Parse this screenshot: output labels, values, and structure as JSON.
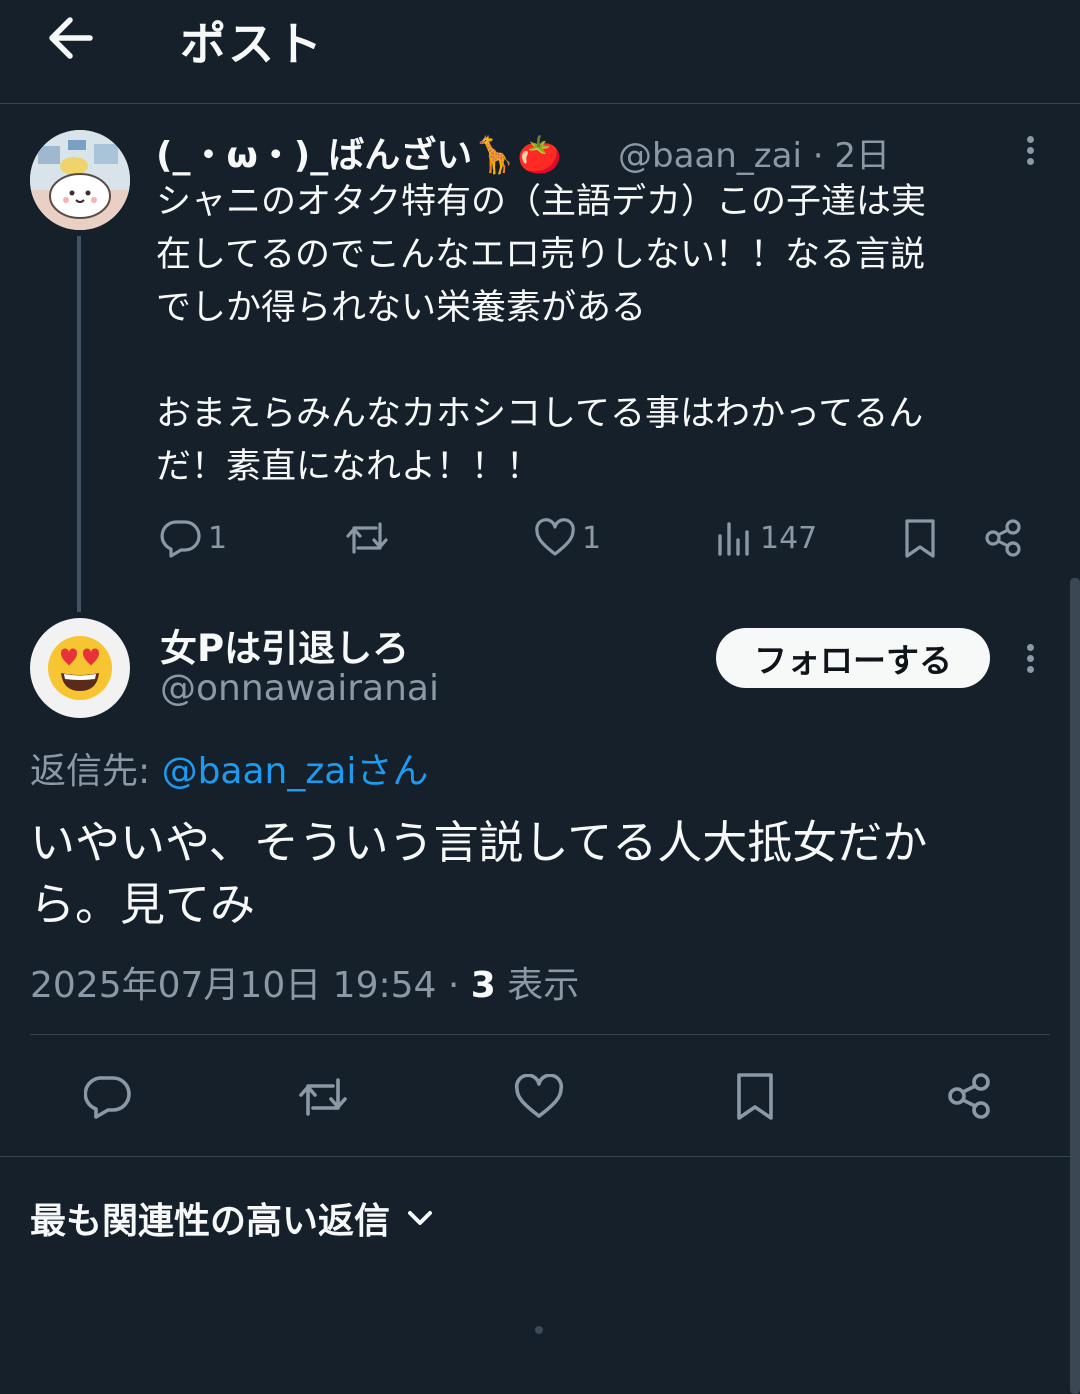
{
  "header": {
    "title": "ポスト"
  },
  "original_post": {
    "display_name": "(_・ω・)_ばんざい🦒🍅",
    "handle_and_time": "@baan_zai · 2日",
    "text": "シャニのオタク特有の（主語デカ）この子達は実\n在してるのでこんなエロ売りしない！！なる言説\nでしか得られない栄養素がある\n\nおまえらみんなカホシコしてる事はわかってるん\nだ！素直になれよ！！！",
    "stats": {
      "replies": "1",
      "reposts": "",
      "likes": "1",
      "views": "147"
    }
  },
  "reply_post": {
    "display_name": "女Pは引退しろ",
    "handle": "@onnawairanai",
    "follow_label": "フォローする",
    "reply_to_prefix": "返信先: ",
    "reply_to_handle": "@baan_zaiさん",
    "text": "いやいや、そういう言説してる人大抵女だか\nら。見てみ",
    "timestamp": "2025年07月10日 19:54 · ",
    "views_count": "3",
    "views_label": " 表示"
  },
  "replies_sort": {
    "label": "最も関連性の高い返信"
  },
  "icons": [
    "back-arrow-icon",
    "more-icon",
    "reply-icon",
    "repost-icon",
    "like-icon",
    "views-icon",
    "bookmark-icon",
    "share-icon",
    "chevron-down-icon"
  ],
  "colors": {
    "background": "#15202b",
    "text": "#f7f9f9",
    "secondary": "#8b98a5",
    "link": "#1d9bf0",
    "divider": "#38444d"
  }
}
